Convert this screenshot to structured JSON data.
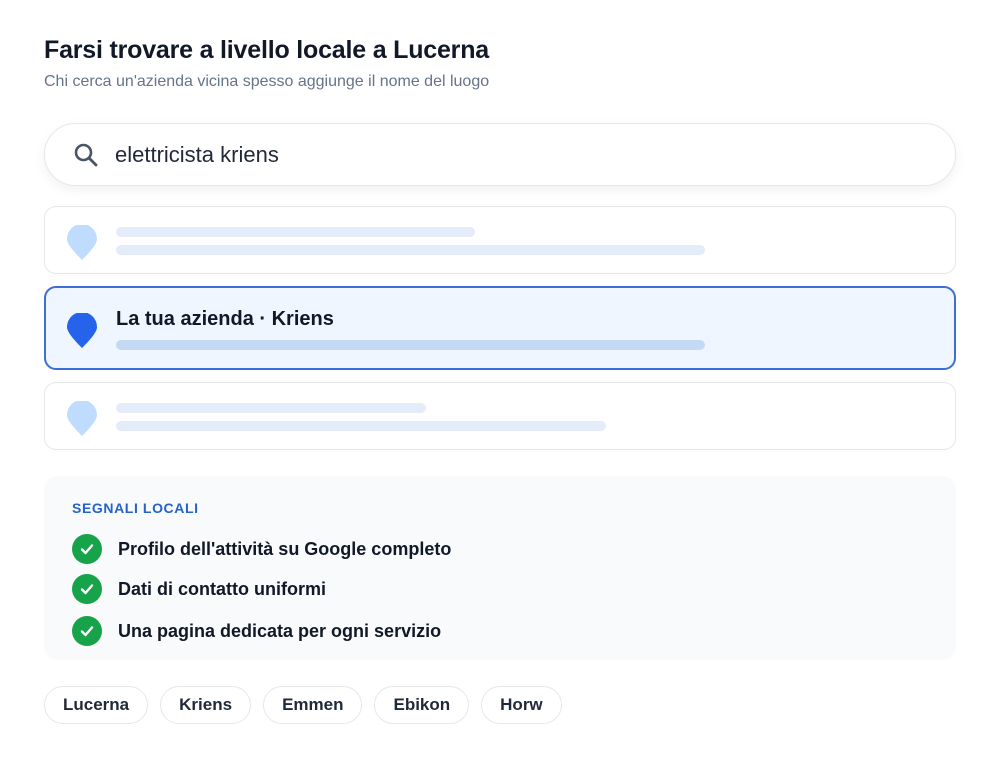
{
  "header": {
    "title": "Farsi trovare a livello locale a Lucerna",
    "subtitle": "Chi cerca un'azienda vicina spesso aggiunge il nome del luogo"
  },
  "search": {
    "query": "elettricista kriens",
    "icon": "search-icon"
  },
  "results": [
    {
      "placeholder": true,
      "pin_color": "#bfdbfe"
    },
    {
      "name": "La tua azienda · Kriens",
      "highlighted": true,
      "pin_color": "#2563eb"
    },
    {
      "placeholder": true,
      "pin_color": "#bfdbfe"
    }
  ],
  "signals": {
    "title": "SEGNALI LOCALI",
    "items": [
      "Profilo dell'attività su Google completo",
      "Dati di contatto uniformi",
      "Una pagina dedicata per ogni servizio"
    ],
    "check_color": "#16a34a"
  },
  "chips": [
    "Lucerna",
    "Kriens",
    "Emmen",
    "Ebikon",
    "Horw"
  ],
  "colors": {
    "accent": "#2563eb",
    "highlight_bg": "#eff6ff",
    "signals_title": "#2563c9"
  }
}
